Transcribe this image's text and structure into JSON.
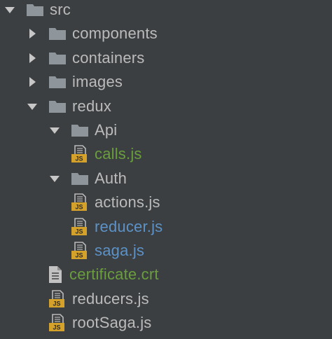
{
  "tree": {
    "rows": [
      {
        "label": "src",
        "kind": "folder",
        "state": "expanded",
        "level": 0,
        "color": "default"
      },
      {
        "label": "components",
        "kind": "folder",
        "state": "collapsed",
        "level": 1,
        "color": "default"
      },
      {
        "label": "containers",
        "kind": "folder",
        "state": "collapsed",
        "level": 1,
        "color": "default"
      },
      {
        "label": "images",
        "kind": "folder",
        "state": "collapsed",
        "level": 1,
        "color": "default"
      },
      {
        "label": "redux",
        "kind": "folder",
        "state": "expanded",
        "level": 1,
        "color": "default"
      },
      {
        "label": "Api",
        "kind": "folder",
        "state": "expanded",
        "level": 2,
        "color": "default"
      },
      {
        "label": "calls.js",
        "kind": "js",
        "level": 3,
        "color": "green"
      },
      {
        "label": "Auth",
        "kind": "folder",
        "state": "expanded",
        "level": 2,
        "color": "default"
      },
      {
        "label": "actions.js",
        "kind": "js",
        "level": 3,
        "color": "default"
      },
      {
        "label": "reducer.js",
        "kind": "js",
        "level": 3,
        "color": "blue"
      },
      {
        "label": "saga.js",
        "kind": "js",
        "level": 3,
        "color": "blue"
      },
      {
        "label": "certificate.crt",
        "kind": "crt",
        "level": 2,
        "color": "green"
      },
      {
        "label": "reducers.js",
        "kind": "js",
        "level": 2,
        "color": "default"
      },
      {
        "label": "rootSaga.js",
        "kind": "js",
        "level": 2,
        "color": "default"
      }
    ]
  },
  "icons": {
    "expanded": "chevron-down-icon",
    "collapsed": "chevron-right-icon",
    "folder": "folder-icon",
    "js": "js-file-icon",
    "crt": "certificate-file-icon"
  },
  "colors": {
    "background": "#3c3f41",
    "text_default": "#bbbbbb",
    "text_green": "#6a9e3d",
    "text_blue": "#5c92c8",
    "folder": "#8e969b",
    "js_badge": "#d4a12a",
    "arrow": "#c7c7c7"
  }
}
